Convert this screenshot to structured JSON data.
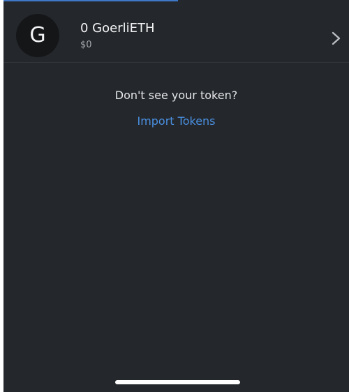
{
  "token": {
    "avatar_letter": "G",
    "amount": "0 GoerliETH",
    "fiat_value": "$0"
  },
  "empty_state": {
    "message": "Don't see your token?",
    "import_link": "Import Tokens"
  },
  "colors": {
    "background": "#24272b",
    "primary_text": "#f2f3f4",
    "secondary_text": "#a6a9ad",
    "link": "#4a90e2",
    "tab_indicator": "#3f78c9"
  },
  "icons": {
    "row_arrow": "chevron-right-icon"
  }
}
